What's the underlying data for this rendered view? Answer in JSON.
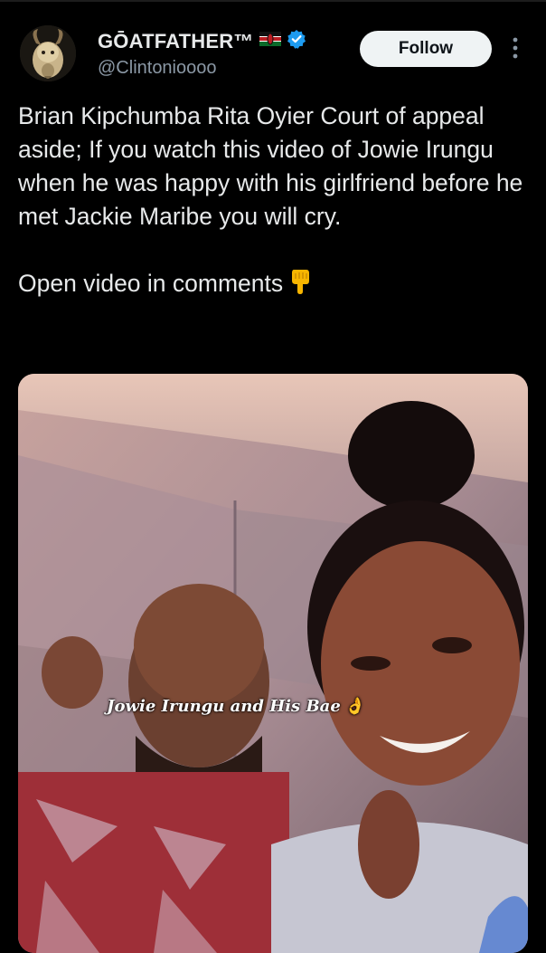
{
  "author": {
    "display_name": "GŌATFATHER™",
    "handle": "@Clintonioooo",
    "verified": true,
    "avatar_icon": "goat-avatar",
    "flag_icon": "kenya-flag-icon"
  },
  "actions": {
    "follow_label": "Follow",
    "more_icon": "more-vertical-icon"
  },
  "tweet": {
    "paragraph_1": "Brian Kipchumba Rita Oyier Court of appeal aside; If you watch this video of Jowie Irungu when he was happy with his girlfriend before he met Jackie Maribe you will cry.",
    "paragraph_2": "Open video in comments",
    "paragraph_2_emoji": "backhand-index-pointing-down"
  },
  "media": {
    "type": "video-thumbnail",
    "caption": "Jowie Irungu and His Bae",
    "caption_emoji": "👌"
  },
  "colors": {
    "background": "#000000",
    "text": "#e7e9ea",
    "secondary": "#8b98a5",
    "verified": "#1d9bf0",
    "follow_bg": "#eff3f4"
  }
}
